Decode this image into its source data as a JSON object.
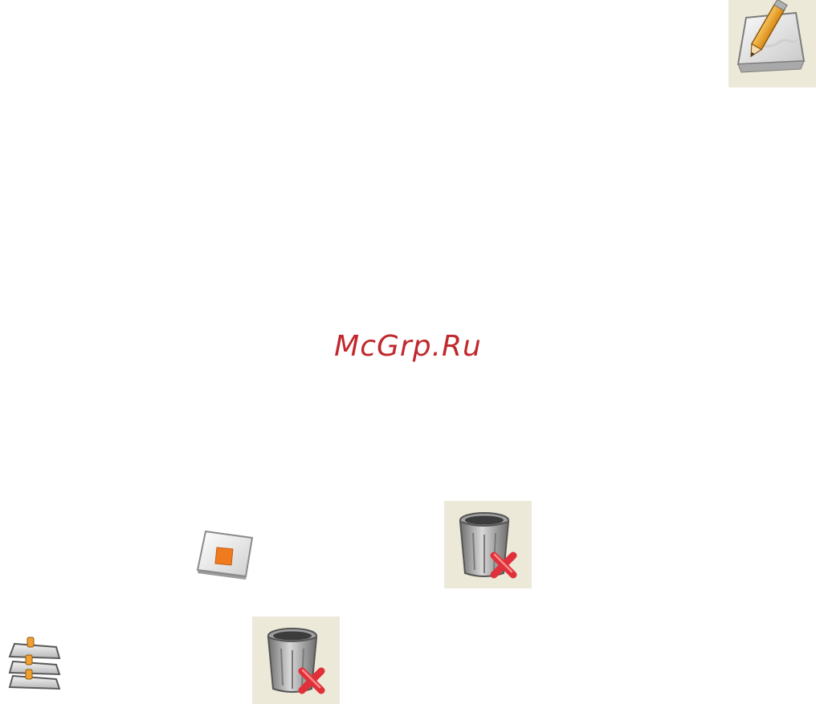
{
  "watermark": {
    "text": "McGrp.Ru",
    "color": "#c0282d"
  },
  "colors": {
    "icon_tile_background": "#ece9d8",
    "pencil_orange": "#f0a030",
    "stop_square": "#f07a1e",
    "delete_x_red": "#e0303a",
    "trash_gray": "#8a8a8a"
  },
  "icons": {
    "edit": "edit-pencil-icon",
    "stop": "stop-square-icon",
    "delete_top": "trash-delete-icon",
    "layers": "stacked-layers-icon",
    "delete_bottom": "trash-delete-icon"
  }
}
